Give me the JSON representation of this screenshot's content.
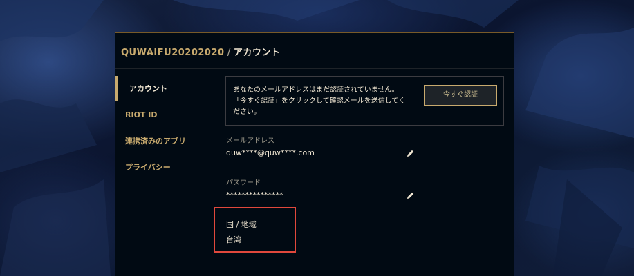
{
  "breadcrumb": {
    "username": "QUWAIFU20202020",
    "separator": "/",
    "current": "アカウント"
  },
  "sidebar": {
    "items": [
      {
        "label": "アカウント",
        "active": true
      },
      {
        "label": "RIOT ID",
        "active": false
      },
      {
        "label": "連携済みのアプリ",
        "active": false
      },
      {
        "label": "プライバシー",
        "active": false
      }
    ]
  },
  "notice": {
    "line1": "あなたのメールアドレスはまだ認証されていません。",
    "line2": "「今すぐ認証」をクリックして確認メールを送信してく",
    "line3": "ださい。",
    "button_label": "今すぐ認証"
  },
  "email": {
    "label": "メールアドレス",
    "value": "quw****@quw****.com",
    "edit_icon": "pencil-icon"
  },
  "password": {
    "label": "パスワード",
    "value": "***************",
    "edit_icon": "pencil-icon"
  },
  "country": {
    "label": "国 / 地域",
    "value": "台湾"
  },
  "colors": {
    "gold": "#c8aa6e",
    "panel_background": "#010a13",
    "text_light": "#f0e6d2",
    "highlight_red": "#e0483c"
  }
}
